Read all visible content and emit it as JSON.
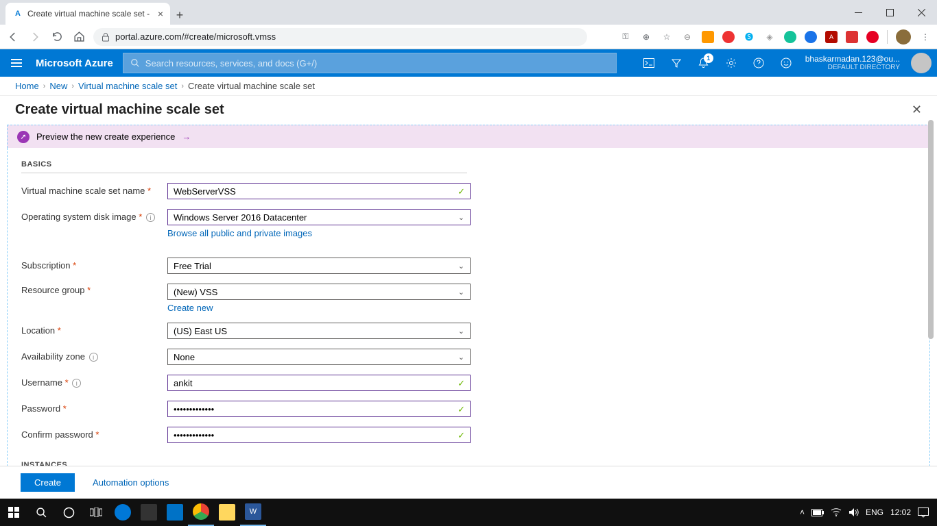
{
  "browser": {
    "tab_title": "Create virtual machine scale set -",
    "url": "portal.azure.com/#create/microsoft.vmss"
  },
  "azure_header": {
    "brand": "Microsoft Azure",
    "search_placeholder": "Search resources, services, and docs (G+/)",
    "notification_count": "1",
    "user_email": "bhaskarmadan.123@ou...",
    "directory": "DEFAULT DIRECTORY"
  },
  "breadcrumb": {
    "home": "Home",
    "new": "New",
    "vmss": "Virtual machine scale set",
    "current": "Create virtual machine scale set"
  },
  "blade": {
    "title": "Create virtual machine scale set",
    "preview_text": "Preview the new create experience"
  },
  "sections": {
    "basics": "BASICS",
    "instances": "INSTANCES"
  },
  "form": {
    "name_label": "Virtual machine scale set name",
    "name_value": "WebServerVSS",
    "os_label": "Operating system disk image",
    "os_value": "Windows Server 2016 Datacenter",
    "browse_link": "Browse all public and private images",
    "sub_label": "Subscription",
    "sub_value": "Free Trial",
    "rg_label": "Resource group",
    "rg_value": "(New) VSS",
    "create_new": "Create new",
    "loc_label": "Location",
    "loc_value": "(US) East US",
    "az_label": "Availability zone",
    "az_value": "None",
    "user_label": "Username",
    "user_value": "ankit",
    "pwd_label": "Password",
    "pwd_value": "•••••••••••••",
    "cpwd_label": "Confirm password",
    "cpwd_value": "•••••••••••••"
  },
  "footer": {
    "create": "Create",
    "automation": "Automation options"
  },
  "taskbar": {
    "lang": "ENG",
    "time": "12:02"
  }
}
